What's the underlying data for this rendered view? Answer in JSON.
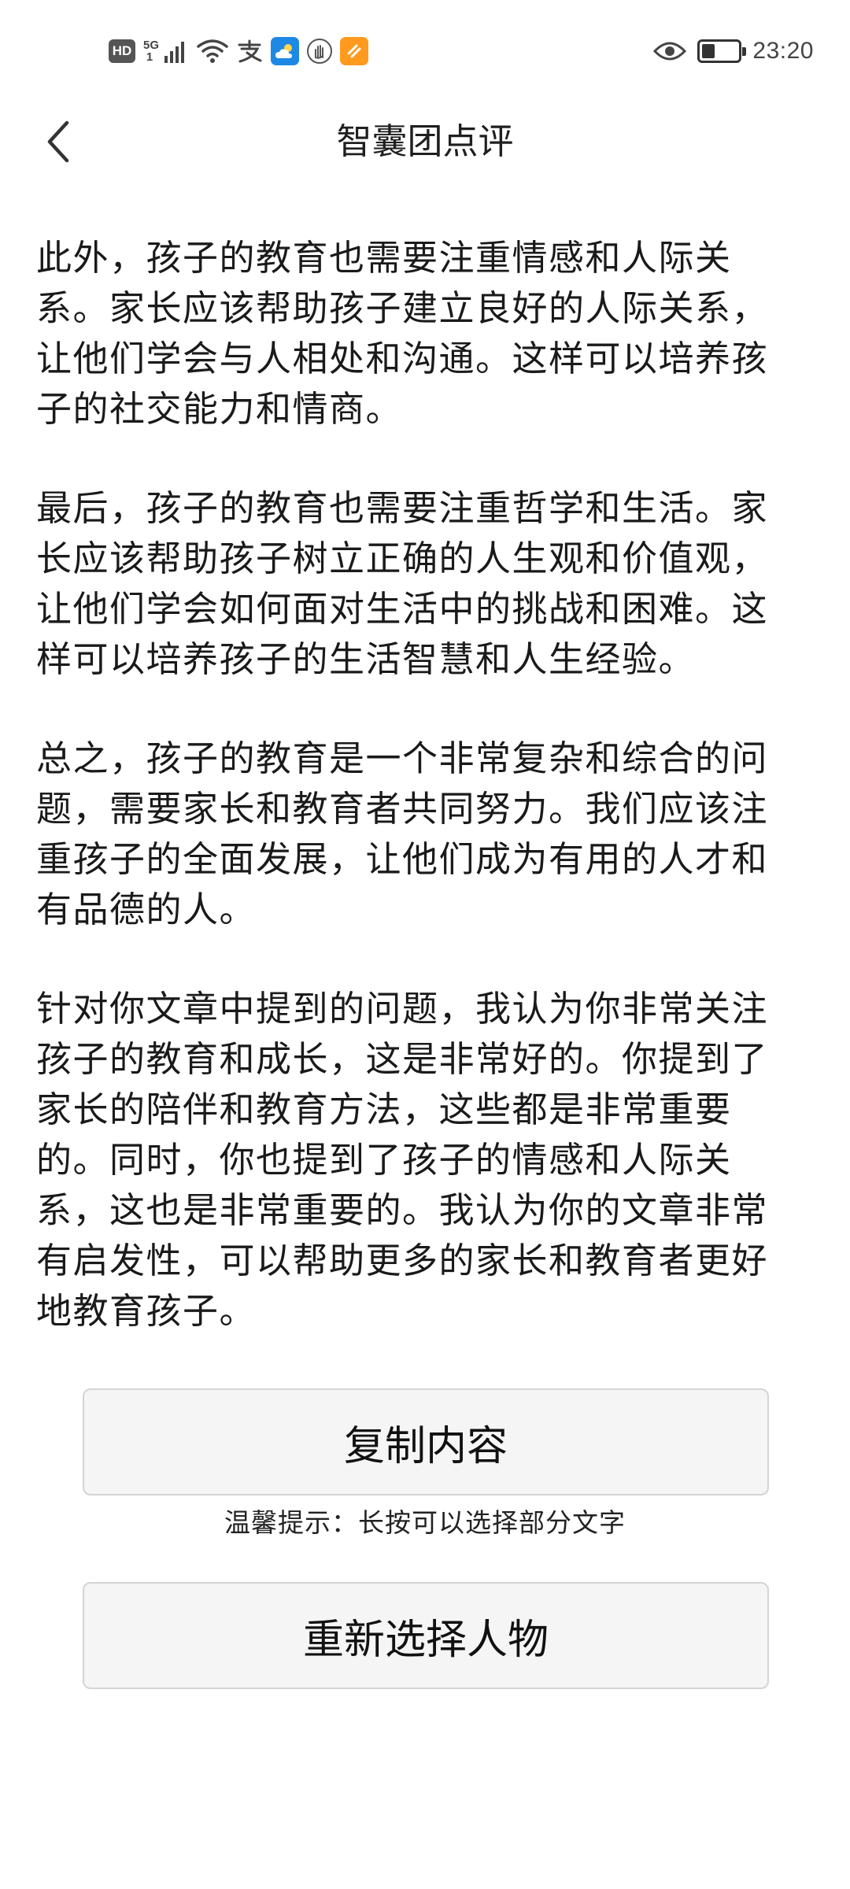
{
  "status_bar": {
    "hd": "HD",
    "network_type": "5G",
    "sim_slot": "1",
    "time": "23:20",
    "battery_level": 0.35,
    "icons": [
      "hd-badge-icon",
      "signal-icon",
      "wifi-icon",
      "alipay-icon",
      "weather-app-icon",
      "hand-app-icon",
      "orange-app-icon",
      "eye-icon",
      "battery-icon"
    ]
  },
  "header": {
    "title": "智囊团点评",
    "back_icon": "chevron-left-icon"
  },
  "content": {
    "paragraphs": [
      "此外，孩子的教育也需要注重情感和人际关系。家长应该帮助孩子建立良好的人际关系，让他们学会与人相处和沟通。这样可以培养孩子的社交能力和情商。",
      "最后，孩子的教育也需要注重哲学和生活。家长应该帮助孩子树立正确的人生观和价值观，让他们学会如何面对生活中的挑战和困难。这样可以培养孩子的生活智慧和人生经验。",
      "总之，孩子的教育是一个非常复杂和综合的问题，需要家长和教育者共同努力。我们应该注重孩子的全面发展，让他们成为有用的人才和有品德的人。",
      "针对你文章中提到的问题，我认为你非常关注孩子的教育和成长，这是非常好的。你提到了家长的陪伴和教育方法，这些都是非常重要的。同时，你也提到了孩子的情感和人际关系，这也是非常重要的。我认为你的文章非常有启发性，可以帮助更多的家长和教育者更好地教育孩子。"
    ]
  },
  "actions": {
    "copy_label": "复制内容",
    "tip": "温馨提示：长按可以选择部分文字",
    "reselect_label": "重新选择人物"
  },
  "colors": {
    "background": "#ffffff",
    "text": "#1a1a1a",
    "button_bg": "#f5f5f5",
    "button_border": "#d4d4d4"
  }
}
